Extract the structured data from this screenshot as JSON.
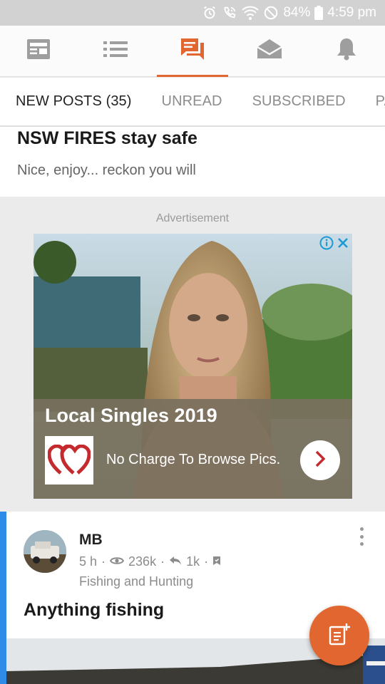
{
  "status_bar": {
    "battery": "84%",
    "time": "4:59 pm",
    "icons": [
      "alarm-icon",
      "wifi-call-icon",
      "wifi-icon",
      "do-not-disturb-icon",
      "battery-icon"
    ]
  },
  "top_nav": {
    "items": [
      {
        "name": "news-icon",
        "active": false
      },
      {
        "name": "list-icon",
        "active": true
      },
      {
        "name": "forum-icon",
        "active": true
      },
      {
        "name": "messages-icon",
        "active": false
      },
      {
        "name": "notifications-icon",
        "active": false
      }
    ],
    "accent_color": "#e2662f"
  },
  "tabs": [
    {
      "label": "NEW POSTS (35)",
      "active": true
    },
    {
      "label": "UNREAD",
      "active": false
    },
    {
      "label": "SUBSCRIBED",
      "active": false
    },
    {
      "label": "PA",
      "active": false
    }
  ],
  "snippet": {
    "title": "NSW FIRES stay safe",
    "body": "Nice, enjoy... reckon you will"
  },
  "ad": {
    "label": "Advertisement",
    "headline": "Local Singles 2019",
    "tagline": "No Charge To Browse Pics.",
    "icons": [
      "adchoices-info-icon",
      "close-icon",
      "hearts-logo-icon",
      "chevron-right-icon"
    ]
  },
  "thread": {
    "author": "MB",
    "age": "5 h",
    "views": "236k",
    "replies": "1k",
    "category": "Fishing and Hunting",
    "title": "Anything fishing",
    "accent_color": "#2e8be8"
  },
  "fab": {
    "icon": "new-post-icon",
    "color": "#e2662f"
  }
}
